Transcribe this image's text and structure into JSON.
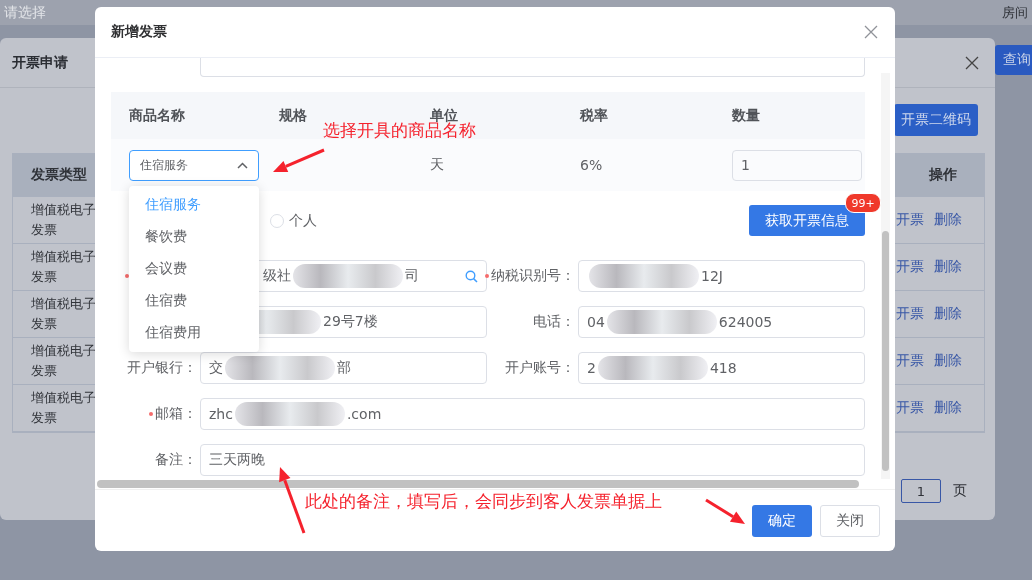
{
  "background_page": {
    "filter_placeholder": "请选择",
    "column_label": "房间",
    "query_button": "查询"
  },
  "invoice_request_dialog": {
    "title": "开票申请",
    "qr_button": "开票二维码",
    "table": {
      "columns": [
        "发票类型",
        "操作"
      ],
      "rows": [
        {
          "invoice_type": "增值税电子发票",
          "actions": [
            "开票",
            "删除"
          ]
        },
        {
          "invoice_type": "增值税电子发票",
          "actions": [
            "开票",
            "删除"
          ]
        },
        {
          "invoice_type": "增值税电子发票",
          "actions": [
            "开票",
            "删除"
          ]
        },
        {
          "invoice_type": "增值税电子发票",
          "actions": [
            "开票",
            "删除"
          ]
        },
        {
          "invoice_type": "增值税电子发票",
          "actions": [
            "开票",
            "删除"
          ]
        }
      ]
    },
    "pagination": {
      "page": "1",
      "page_suffix": "页"
    }
  },
  "new_invoice_dialog": {
    "title": "新增发票",
    "goods_table": {
      "columns": [
        "商品名称",
        "规格",
        "单位",
        "税率",
        "数量"
      ],
      "rows": [
        {
          "name": "住宿服务",
          "unit": "天",
          "tax_rate": "6%",
          "quantity": "1"
        }
      ]
    },
    "name_dropdown": {
      "expanded": true,
      "options": [
        {
          "label": "住宿服务",
          "selected": true
        },
        {
          "label": "餐饮费",
          "selected": false
        },
        {
          "label": "会议费",
          "selected": false
        },
        {
          "label": "住宿费",
          "selected": false
        },
        {
          "label": "住宿费用",
          "selected": false
        }
      ]
    },
    "buyer_type_option": {
      "label": "个人",
      "selected": false
    },
    "fetch_button": {
      "label": "获取开票信息",
      "badge": "99+"
    },
    "fields": [
      {
        "kind": "search",
        "required": true,
        "redacted": true,
        "value_start": "级社",
        "value_end": "司"
      },
      {
        "kind": "text",
        "label": "纳税识别号：",
        "required": true,
        "redacted": true,
        "value_end": "12J"
      },
      {
        "kind": "text",
        "required": false,
        "redacted": true,
        "value_end": "29号7楼"
      },
      {
        "kind": "text",
        "label": "电话：",
        "required": false,
        "redacted": true,
        "value_start": "04",
        "value_end": "624005"
      },
      {
        "kind": "text",
        "label": "开户银行：",
        "required": false,
        "redacted": true,
        "value_start": "交",
        "value_end": "部"
      },
      {
        "kind": "text",
        "label": "开户账号：",
        "required": false,
        "redacted": true,
        "value_start": "2",
        "value_end": "418"
      },
      {
        "kind": "wide",
        "label": "邮箱：",
        "required": true,
        "redacted": true,
        "value_start": "zhc",
        "value_end": ".com"
      },
      {
        "kind": "wide",
        "label": "备注：",
        "required": false,
        "redacted": false,
        "value_start": "三天两晚"
      }
    ],
    "footer_buttons": [
      {
        "label": "确定",
        "kind": "primary"
      },
      {
        "label": "关闭",
        "kind": "default"
      }
    ]
  },
  "annotations": [
    {
      "text": "选择开具的商品名称"
    },
    {
      "text": "此处的备注，填写后，会同步到客人发票单据上"
    }
  ]
}
